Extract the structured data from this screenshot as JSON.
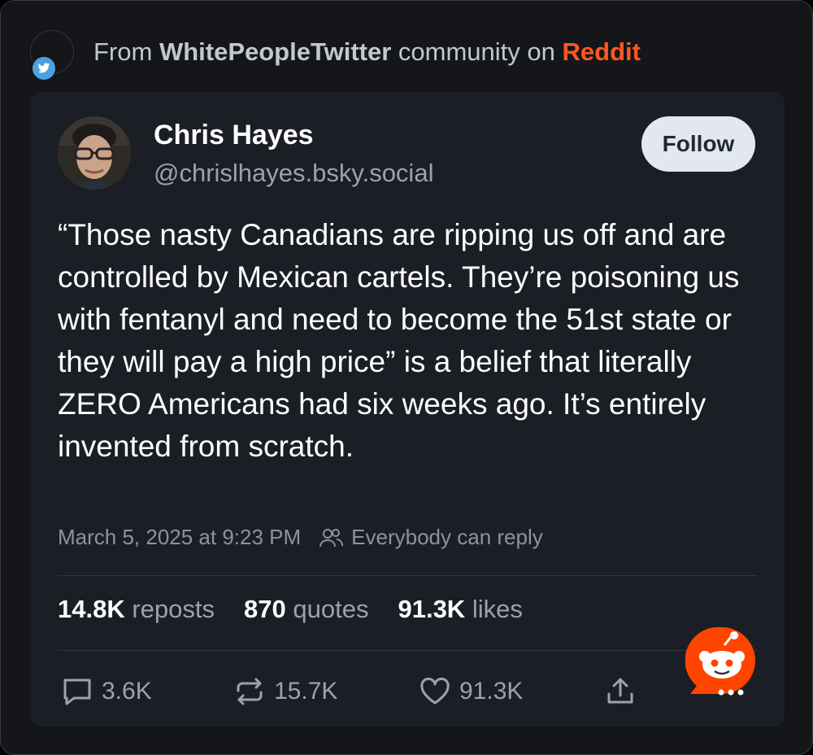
{
  "source": {
    "prefix": "From",
    "community": "WhitePeopleTwitter",
    "middle": "community on",
    "platform": "Reddit"
  },
  "post": {
    "author_name": "Chris Hayes",
    "author_handle": "@chrislhayes.bsky.social",
    "follow_label": "Follow",
    "text": "“Those nasty Canadians are ripping us off and are controlled by Mexican cartels. They’re poisoning us with fentanyl and need to become the 51st state or they will pay a high price” is a belief that literally ZERO Americans had six weeks ago. It’s entirely invented from scratch.",
    "timestamp": "March 5, 2025 at 9:23 PM",
    "reply_setting": "Everybody can reply"
  },
  "stats": {
    "reposts_count": "14.8K",
    "reposts_label": "reposts",
    "quotes_count": "870",
    "quotes_label": "quotes",
    "likes_count": "91.3K",
    "likes_label": "likes"
  },
  "actions": {
    "replies": "3.6K",
    "reposts": "15.7K",
    "likes": "91.3K"
  },
  "icons": {
    "bird": "twitter-bird-icon",
    "reply": "reply-bubble-icon",
    "repost": "repost-arrows-icon",
    "like": "heart-icon",
    "share": "share-upload-icon",
    "people": "people-icon",
    "reddit": "reddit-snoo-icon"
  },
  "colors": {
    "background": "#141619",
    "card": "#1b1f25",
    "reddit_accent": "#ff5722",
    "twitter_blue": "#4aa3df",
    "follow_button": "#e3e8ee"
  }
}
